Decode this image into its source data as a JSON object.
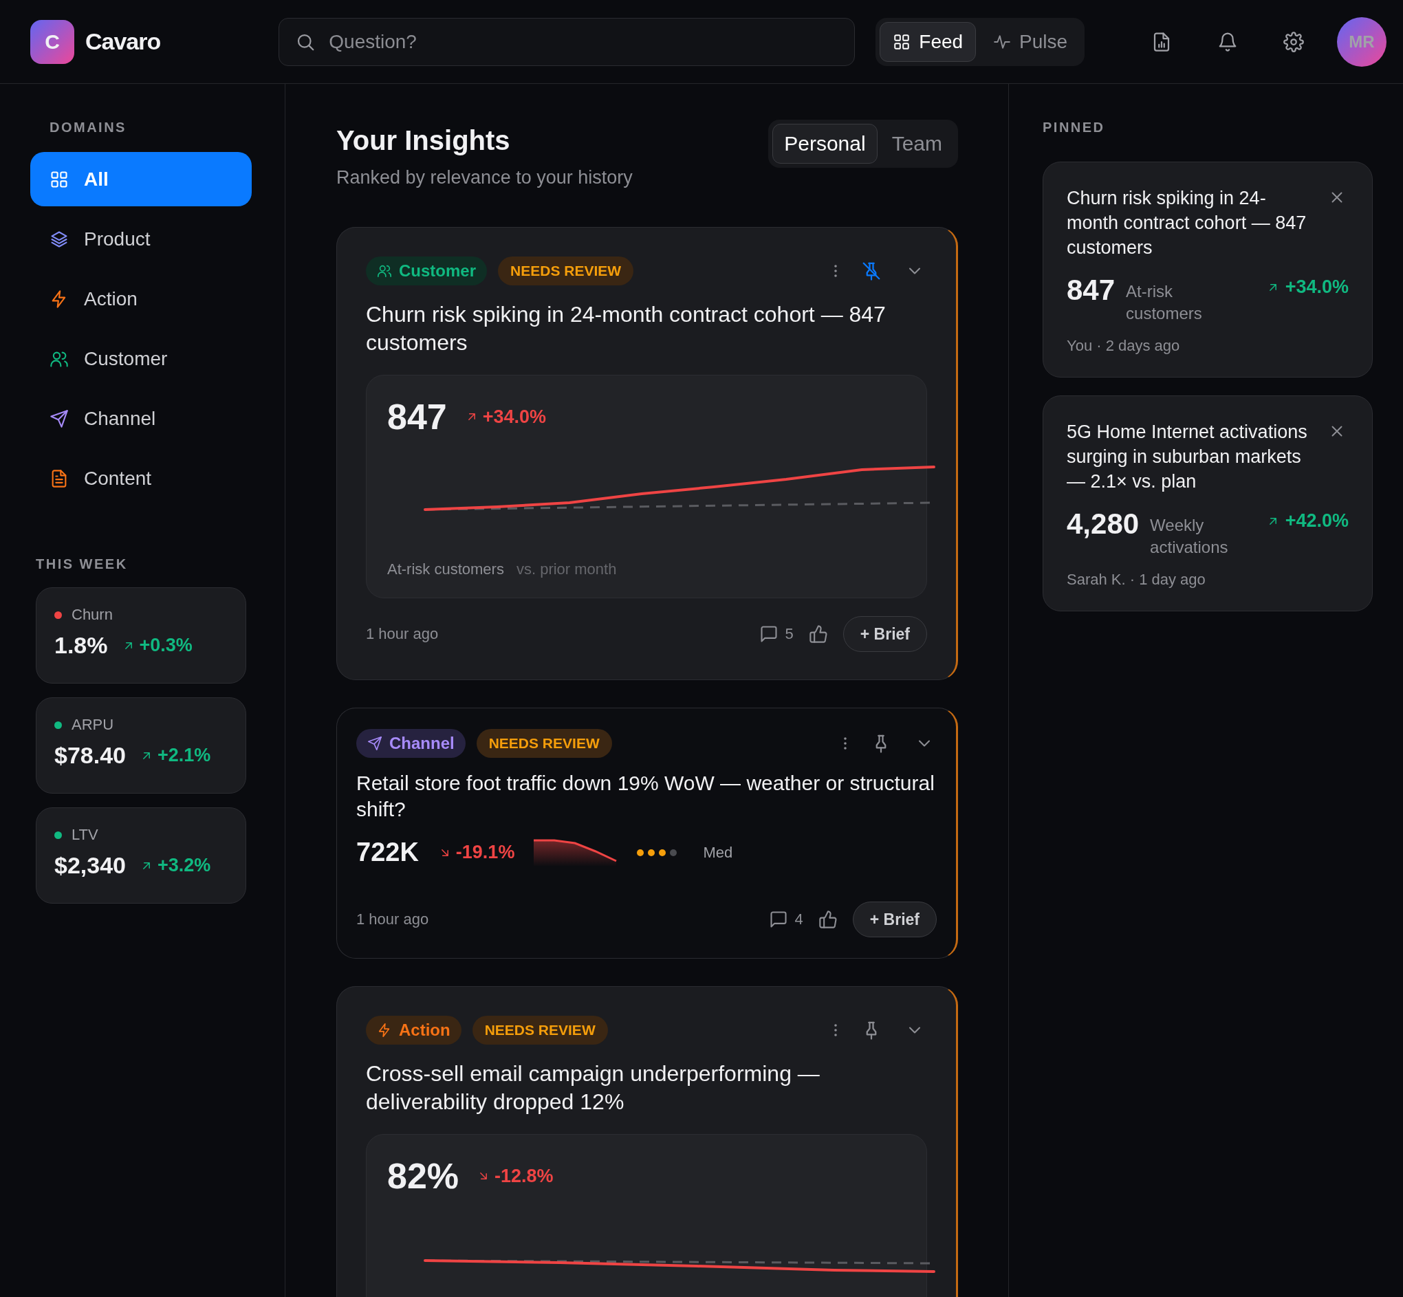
{
  "header": {
    "logo_letter": "C",
    "brand": "Cavaro",
    "search": {
      "placeholder": "Question?"
    },
    "views": [
      {
        "label": "Feed",
        "selected": true
      },
      {
        "label": "Pulse",
        "selected": false
      }
    ],
    "avatar": "MR"
  },
  "sidebar": {
    "domains_heading": "DOMAINS",
    "domains": [
      {
        "label": "All",
        "selected": true
      },
      {
        "label": "Product",
        "selected": false
      },
      {
        "label": "Action",
        "selected": false
      },
      {
        "label": "Customer",
        "selected": false
      },
      {
        "label": "Channel",
        "selected": false
      },
      {
        "label": "Content",
        "selected": false
      }
    ],
    "week_heading": "THIS WEEK",
    "metrics": [
      {
        "label": "Churn",
        "color": "#ef4444",
        "value": "1.8%",
        "delta": "+0.3%"
      },
      {
        "label": "ARPU",
        "color": "#10b981",
        "value": "$78.40",
        "delta": "+2.1%"
      },
      {
        "label": "LTV",
        "color": "#10b981",
        "value": "$2,340",
        "delta": "+3.2%"
      }
    ]
  },
  "main": {
    "title": "Your Insights",
    "subtitle": "Ranked by relevance to your history",
    "scopes": [
      {
        "label": "Personal",
        "selected": true
      },
      {
        "label": "Team",
        "selected": false
      }
    ],
    "cards": [
      {
        "kind": "expanded",
        "tag": {
          "kind": "customer",
          "label": "Customer"
        },
        "status": "NEEDS REVIEW",
        "pinned": true,
        "title": "Churn risk spiking in 24-month contract cohort — 847 customers",
        "value": "847",
        "delta": "+34.0%",
        "rising": true,
        "alert": true,
        "caption": "At-risk customers",
        "comparison": "vs. prior month",
        "time": "1 hour ago",
        "comments": "5",
        "brief": "+ Brief"
      },
      {
        "kind": "compact",
        "tag": {
          "kind": "channel",
          "label": "Channel"
        },
        "status": "NEEDS REVIEW",
        "pinned": false,
        "title": "Retail store foot traffic down 19% WoW — weather or structural shift?",
        "value": "722K",
        "delta": "-19.1%",
        "rising": false,
        "alert": true,
        "stars": 3,
        "confidence": "Med",
        "time": "1 hour ago",
        "comments": "4",
        "brief": "+ Brief"
      },
      {
        "kind": "expanded",
        "tag": {
          "kind": "action",
          "label": "Action"
        },
        "status": "NEEDS REVIEW",
        "pinned": false,
        "title": "Cross-sell email campaign underperforming — deliverability dropped 12%",
        "value": "82%",
        "delta": "-12.8%",
        "rising": false,
        "alert": true
      }
    ]
  },
  "pinned": {
    "heading": "PINNED",
    "cards": [
      {
        "title": "Churn risk spiking in 24-month contract cohort — 847 customers",
        "value": "847",
        "label": "At-risk customers",
        "delta": "+34.0%",
        "meta": "You · 2 days ago"
      },
      {
        "title": "5G Home Internet activations surging in suburban markets — 2.1× vs. plan",
        "value": "4,280",
        "label": "Weekly activations",
        "delta": "+42.0%",
        "meta": "Sarah K. · 1 day ago"
      }
    ]
  }
}
